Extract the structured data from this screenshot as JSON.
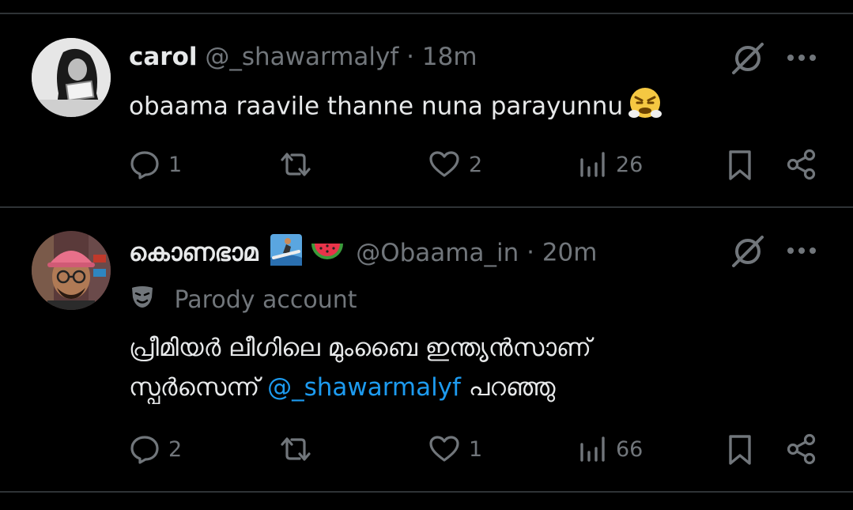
{
  "tweets": [
    {
      "name": "carol",
      "handle": "@_shawarmalyf",
      "separator": "·",
      "time": "18m",
      "text": "obaama raavile thanne nuna parayunnu",
      "text_emoji": "face-with-steam-emoji",
      "actions": {
        "replies": "1",
        "reposts": "",
        "likes": "2",
        "views": "26"
      }
    },
    {
      "name": "കൊണഭാമ",
      "name_badges": [
        "surfer-emoji",
        "watermelon-emoji"
      ],
      "handle": "@Obaama_in",
      "separator": "·",
      "time": "20m",
      "parody_label": "Parody account",
      "text_line1": "പ്രീമിയർ ലീഗിലെ മുംബൈ ഇന്ത്യൻസാണ്",
      "text_line2_mention": "@_shawarmalyf",
      "text_line2_prefix": "സ്പർസെന്ന്",
      "text_line2_suffix": "പറഞ്ഞു",
      "actions": {
        "replies": "2",
        "reposts": "",
        "likes": "1",
        "views": "66"
      }
    }
  ],
  "colors": {
    "background": "#000000",
    "text": "#e7e9ea",
    "secondary": "#71767b",
    "link": "#1d9bf0",
    "divider": "#2f3336"
  }
}
